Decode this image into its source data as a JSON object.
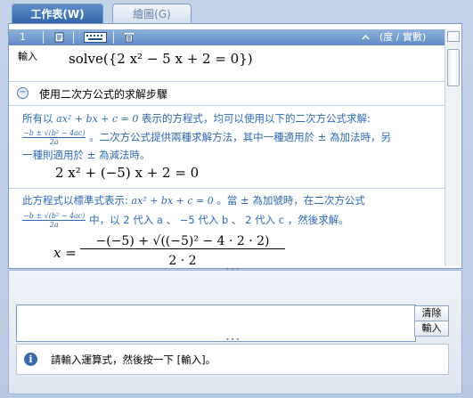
{
  "tabs": {
    "worksheet": "工作表(W)",
    "graph": "繪圖(G)"
  },
  "toolbar": {
    "index": "1",
    "mode": "(度 / 實數)"
  },
  "entry": {
    "label": "輸入",
    "expression": "solve({2 x² − 5 x + 2 = 0})"
  },
  "steps": {
    "title": "使用二次方公式的求解步驟",
    "p1a": "所有以",
    "p1_form": "ax² + bx + c = 0",
    "p1b": "表示的方程式，均可以使用以下的二次方公式求解:",
    "p2": "。二次方公式提供兩種求解方法，其中一種適用於 ± 為加法時，另",
    "p3": "一種則適用於 ± 為減法時。",
    "eq1": "2 x² + (−5) x + 2 = 0",
    "p4a": "此方程式以標準式表示:",
    "p4b": "。當 ± 為加號時，在二次方公式",
    "p5": "中，以 2 代入 a 、 −5 代入 b 、 2 代入 c ，然後求解。",
    "formula_num": "−b ± √(b² − 4ac)",
    "formula_den": "2a",
    "eq2_lhs": "x =",
    "eq2_num": "−(−5) + √((−5)² − 4 · 2 · 2)",
    "eq2_den": "2 · 2"
  },
  "buttons": {
    "clear": "清除",
    "enter": "輸入"
  },
  "status": {
    "message": "請輸入運算式，然後按一下 [輸入]。"
  }
}
